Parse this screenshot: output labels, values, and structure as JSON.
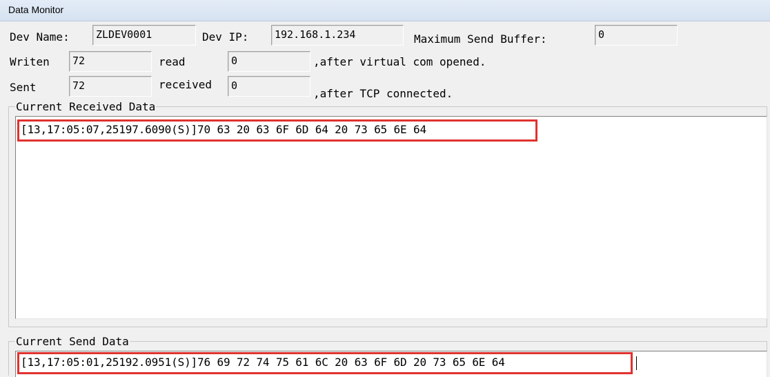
{
  "window": {
    "title": "Data Monitor"
  },
  "device": {
    "name_label": "Dev Name:",
    "name_value": "ZLDEV0001",
    "ip_label": "Dev IP:",
    "ip_value": "192.168.1.234",
    "max_buffer_label": "Maximum Send Buffer:",
    "max_buffer_value": "0"
  },
  "virtual_com": {
    "written_label": "Writen",
    "written_value": "72",
    "read_label": "read",
    "read_value": "0",
    "note": ",after virtual com opened."
  },
  "tcp": {
    "sent_label": "Sent",
    "sent_value": "72",
    "received_label": "received",
    "received_value": "0",
    "note": ",after TCP connected."
  },
  "received_data": {
    "title": "Current Received Data",
    "line": "[13,17:05:07,25197.6090(S)]70 63 20 63 6F 6D 64 20 73 65 6E 64"
  },
  "send_data": {
    "title": "Current Send Data",
    "line": "[13,17:05:01,25192.0951(S)]76 69 72 74 75 61 6C 20 63 6F 6D 20 73 65 6E 64"
  },
  "colors": {
    "highlight": "#e0322f",
    "titlebar": "#dbe6f4"
  }
}
